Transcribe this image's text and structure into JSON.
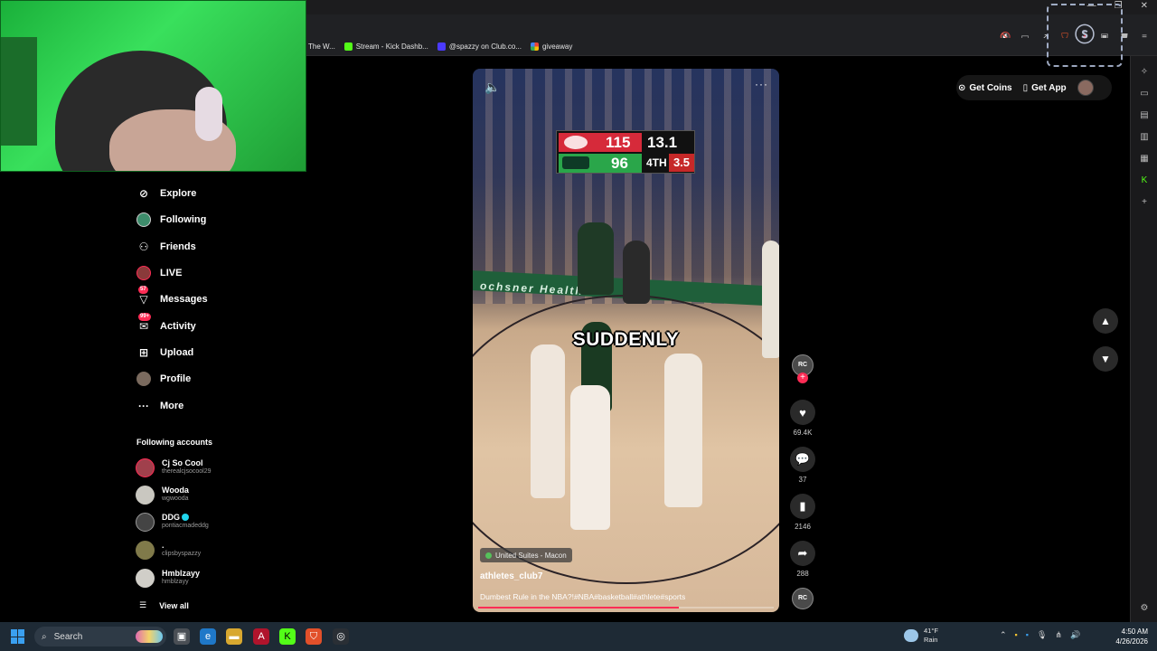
{
  "browser": {
    "bookmarks": [
      {
        "label": "The W...",
        "color": "#444444"
      },
      {
        "label": "Stream - Kick Dashb...",
        "color": "#53fc18"
      },
      {
        "label": "@spazzy on Club.co...",
        "color": "#4b3aff"
      },
      {
        "label": "giveaway",
        "color": "#ffb020"
      }
    ]
  },
  "sidebar": {
    "items": [
      {
        "label": "Explore",
        "icon": "compass-icon"
      },
      {
        "label": "Following",
        "icon": "avatar-icon"
      },
      {
        "label": "Friends",
        "icon": "people-icon"
      },
      {
        "label": "LIVE",
        "icon": "live-icon"
      },
      {
        "label": "Messages",
        "icon": "send-icon",
        "badge": "57"
      },
      {
        "label": "Activity",
        "icon": "inbox-icon",
        "badge": "99+"
      },
      {
        "label": "Upload",
        "icon": "plus-square-icon"
      },
      {
        "label": "Profile",
        "icon": "profile-icon"
      },
      {
        "label": "More",
        "icon": "ellipsis-icon"
      }
    ],
    "following_header": "Following accounts",
    "accounts": [
      {
        "name": "Cj So Cool",
        "handle": "therealcjsocool29"
      },
      {
        "name": "Wooda",
        "handle": "wgwooda"
      },
      {
        "name": "DDG",
        "handle": "pontiacmadeddg"
      },
      {
        "name": ".",
        "handle": "clipsbyspazzy"
      },
      {
        "name": "Hmblzayy",
        "handle": "hmblzayy"
      }
    ],
    "view_all": "View all"
  },
  "video": {
    "scoreboard": {
      "score1": "115",
      "score2": "96",
      "clock": "13.1",
      "quarter": "4TH",
      "shot_clock": "3.5"
    },
    "caption": "SUDDENLY",
    "ad_text": "ochsner Health",
    "location": "United Suites - Macon",
    "author": "athletes_club7",
    "description": "Dumbest Rule in the NBA?!#NBA#basketball#athlete#sports",
    "progress_fraction": 0.68
  },
  "actions": {
    "creator_avatar": "RC",
    "likes": "69.4K",
    "comments": "37",
    "saves": "2146",
    "shares": "288"
  },
  "topbar": {
    "get_coins": "Get Coins",
    "get_app": "Get App"
  },
  "taskbar": {
    "search": "Search",
    "weather_temp": "41°F",
    "weather_desc": "Rain",
    "time": "4:50 AM",
    "date": "4/26/2026"
  },
  "colors": {
    "accent": "#fe2c55",
    "webcam_bg": "#2ccf4a"
  }
}
